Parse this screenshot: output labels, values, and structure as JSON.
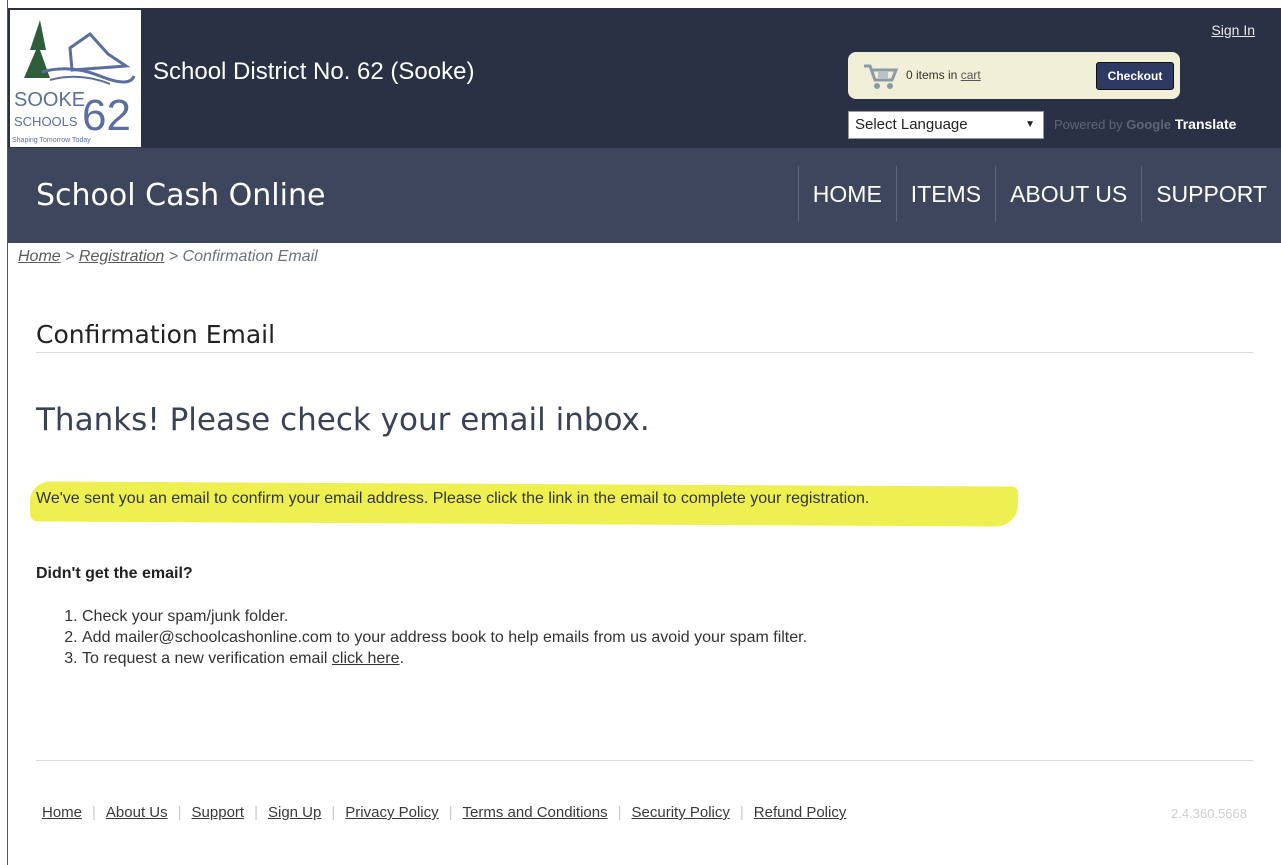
{
  "header": {
    "district_name": "School District No. 62 (Sooke)",
    "sign_in": "Sign In",
    "logo": {
      "name": "SOOKE",
      "sub": "SCHOOLS",
      "number": "62",
      "tagline": "Shaping Tomorrow Today"
    },
    "cart": {
      "count_text": "0 items in ",
      "link": "cart",
      "checkout": "Checkout"
    },
    "language": {
      "selected": "Select Language",
      "powered_by": "Powered by ",
      "google": "Google",
      "translate": " Translate"
    }
  },
  "nav": {
    "brand": "School Cash Online",
    "items": [
      "HOME",
      "ITEMS",
      "ABOUT US",
      "SUPPORT"
    ]
  },
  "breadcrumb": {
    "home": "Home",
    "sep1": " > ",
    "registration": "Registration",
    "sep2": " > ",
    "current": "Confirmation Email"
  },
  "main": {
    "title": "Confirmation Email",
    "thanks": "Thanks! Please check your email inbox.",
    "sent_message": "We've sent you an email to confirm your email address. Please click the link in the email to complete your registration.",
    "didnt_get": "Didn't get the email?",
    "steps": [
      "Check your spam/junk folder.",
      "Add mailer@schoolcashonline.com to your address book to help emails from us avoid your spam filter.",
      "To request a new verification email "
    ],
    "click_here": "click here",
    "step3_end": "."
  },
  "footer": {
    "links": [
      "Home",
      "About Us",
      "Support",
      "Sign Up",
      "Privacy Policy",
      "Terms and Conditions",
      "Security Policy",
      "Refund Policy"
    ],
    "version": "2.4.360.5668"
  },
  "colors": {
    "header_bg": "#2b3144",
    "nav_bg": "#3d465c",
    "highlight": "#eef051",
    "checkout_bg": "#2f3a63"
  }
}
